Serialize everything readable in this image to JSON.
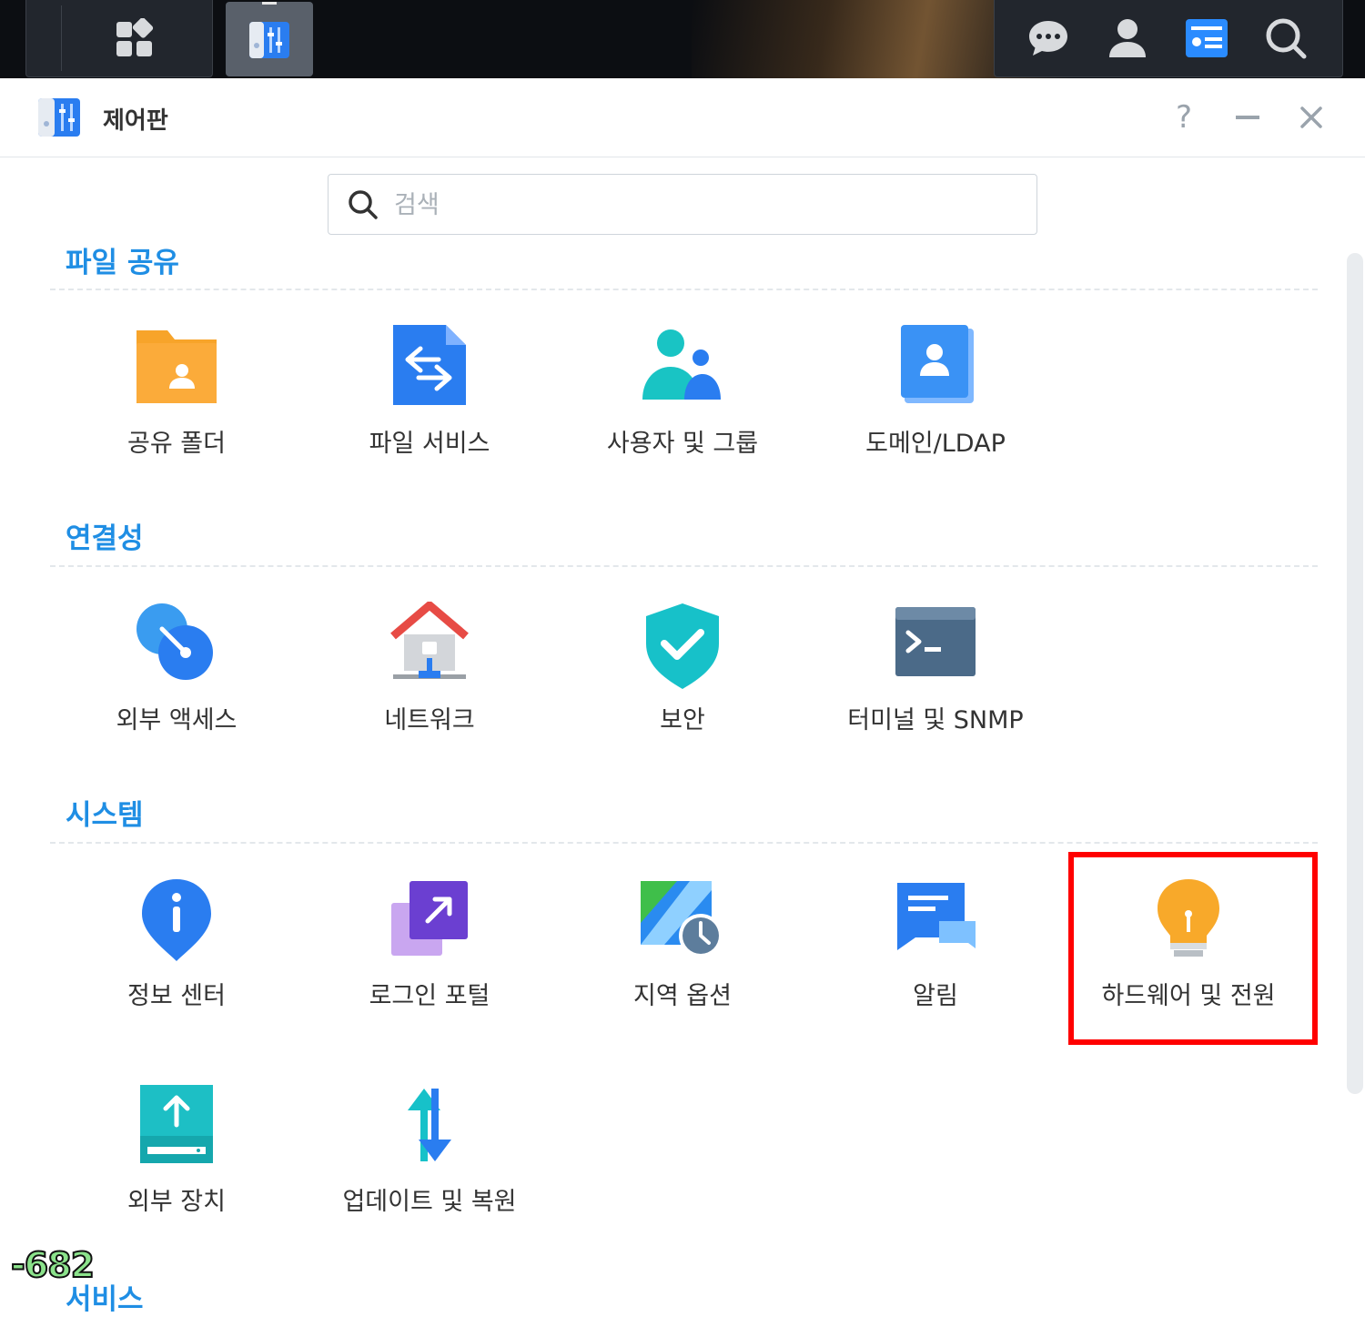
{
  "taskbar": {
    "left_buttons": [
      {
        "name": "main-menu",
        "icon": "apps-grid-icon"
      },
      {
        "name": "control-panel",
        "icon": "control-panel-icon",
        "active": true
      }
    ],
    "right_buttons": [
      {
        "name": "notifications",
        "icon": "chat-bubble-icon"
      },
      {
        "name": "user",
        "icon": "user-icon"
      },
      {
        "name": "widgets",
        "icon": "widgets-icon",
        "active": true
      },
      {
        "name": "search",
        "icon": "search-icon"
      }
    ]
  },
  "window": {
    "title": "제어판",
    "controls": {
      "help": "?"
    }
  },
  "search": {
    "placeholder": "검색"
  },
  "sections": [
    {
      "title": "파일 공유",
      "items": [
        "공유 폴더",
        "파일 서비스",
        "사용자 및 그룹",
        "도메인/LDAP"
      ]
    },
    {
      "title": "연결성",
      "items": [
        "외부 액세스",
        "네트워크",
        "보안",
        "터미널 및 SNMP"
      ]
    },
    {
      "title": "시스템",
      "items": [
        "정보 센터",
        "로그인 포털",
        "지역 옵션",
        "알림",
        "하드웨어 및 전원",
        "외부 장치",
        "업데이트 및 복원"
      ]
    },
    {
      "title": "서비스"
    }
  ],
  "highlighted_item": "하드웨어 및 전원",
  "overlay_badge": "-682",
  "colors": {
    "accent": "#1f8ee4",
    "highlight": "#ff0000",
    "taskbar_bg": "#0c0e12"
  }
}
